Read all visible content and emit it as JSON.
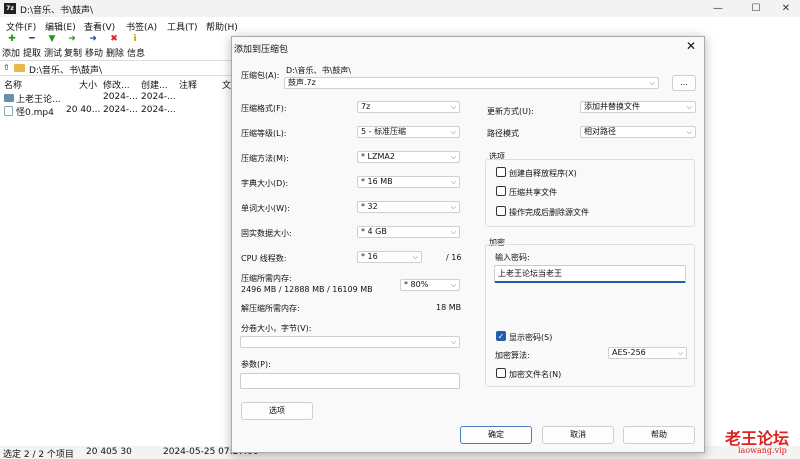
{
  "main": {
    "title": "D:\\音乐、书\\鼓声\\",
    "app_icon": "7z",
    "menu": [
      "文件(F)",
      "编辑(E)",
      "查看(V)",
      "书签(A)",
      "工具(T)",
      "帮助(H)"
    ],
    "toolbar": [
      "添加",
      "提取",
      "测试",
      "复制",
      "移动",
      "删除",
      "信息"
    ],
    "address": "D:\\音乐、书\\鼓声\\",
    "columns": [
      "名称",
      "大小",
      "修改...",
      "创建...",
      "注释",
      "文"
    ],
    "rows": [
      {
        "name": "上老王论...",
        "size": "",
        "modified": "2024-...",
        "created": "2024-..."
      },
      {
        "name": "怪0.mp4",
        "size": "20 40...",
        "modified": "2024-...",
        "created": "2024-..."
      }
    ],
    "status": {
      "selection": "选定 2 / 2 个项目",
      "size": "20 405 30",
      "date": "2024-05-25 07:27:00"
    }
  },
  "dialog": {
    "title": "添加到压缩包",
    "archive_label": "压缩包(A):",
    "archive_path": "D:\\音乐、书\\鼓声\\",
    "archive_name": "鼓声.7z",
    "browse": "...",
    "format_label": "压缩格式(F):",
    "format": "7z",
    "level_label": "压缩等级(L):",
    "level": "5 - 标准压缩",
    "method_label": "压缩方法(M):",
    "method": "* LZMA2",
    "dict_label": "字典大小(D):",
    "dict": "* 16 MB",
    "word_label": "单词大小(W):",
    "word": "* 32",
    "solid_label": "固实数据大小:",
    "solid": "* 4 GB",
    "cpu_label": "CPU 线程数:",
    "cpu": "* 16",
    "cpu_total": "/ 16",
    "mem_comp_label": "压缩所需内存:",
    "mem_comp": "2496 MB / 12888 MB / 16109 MB",
    "mem_pct": "* 80%",
    "mem_decomp_label": "解压缩所需内存:",
    "mem_decomp": "18 MB",
    "split_label": "分卷大小，字节(V):",
    "params_label": "参数(P):",
    "options_btn": "选项",
    "update_label": "更新方式(U):",
    "update": "添加并替换文件",
    "path_label": "路径模式",
    "path_mode": "相对路径",
    "options_group": "选项",
    "opt_sfx": "创建自释放程序(X)",
    "opt_shared": "压缩共享文件",
    "opt_delete": "操作完成后删除源文件",
    "enc_group": "加密",
    "pwd_label": "输入密码:",
    "pwd_value": "上老王论坛当老王",
    "show_pwd": "显示密码(S)",
    "enc_method_label": "加密算法:",
    "enc_method": "AES-256",
    "enc_names": "加密文件名(N)",
    "ok": "确定",
    "cancel": "取消",
    "help": "帮助"
  },
  "watermark": {
    "line1": "老王论坛",
    "line2": "laowang.vip"
  },
  "colors": {
    "accent": "#1f5fae",
    "watermark": "#dd2222"
  }
}
